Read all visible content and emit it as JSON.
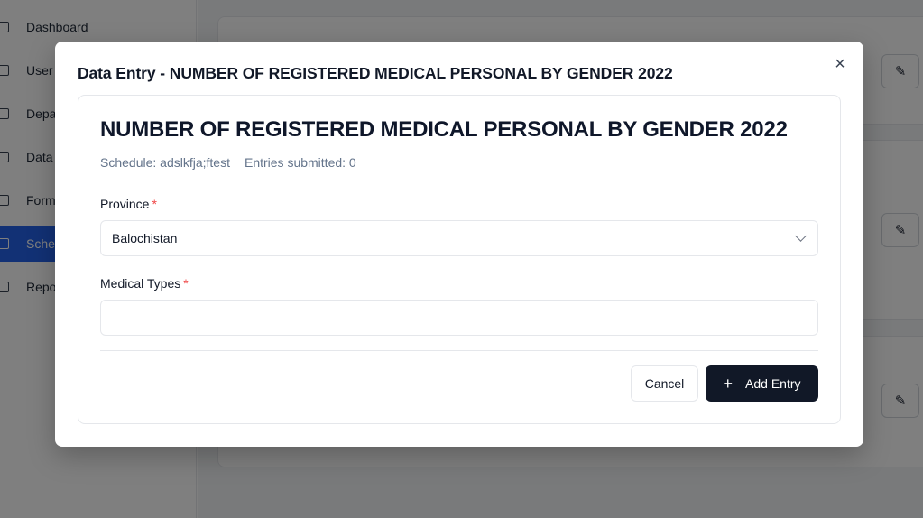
{
  "sidebar": {
    "items": [
      {
        "label": "Dashboard",
        "active": false
      },
      {
        "label": "User",
        "active": false
      },
      {
        "label": "Depa",
        "active": false
      },
      {
        "label": "Data",
        "active": false
      },
      {
        "label": "Form",
        "active": false
      },
      {
        "label": "Sche",
        "active": true
      },
      {
        "label": "Repo",
        "active": false
      }
    ]
  },
  "modal": {
    "title": "Data Entry - NUMBER OF REGISTERED MEDICAL PERSONAL BY GENDER 2022",
    "close_icon": "×",
    "form_title": "NUMBER OF REGISTERED MEDICAL PERSONAL BY GENDER 2022",
    "schedule_text": "Schedule: adslkfja;ftest",
    "entries_text": "Entries submitted: 0",
    "province": {
      "label": "Province",
      "required_mark": "*",
      "value": "Balochistan"
    },
    "medical_types": {
      "label": "Medical Types",
      "required_mark": "*",
      "value": "",
      "placeholder": ""
    },
    "cancel_label": "Cancel",
    "add_icon": "+",
    "add_label": "Add Entry"
  },
  "colors": {
    "accent": "#2563eb",
    "primary_button": "#111827",
    "required": "#ef4444"
  }
}
